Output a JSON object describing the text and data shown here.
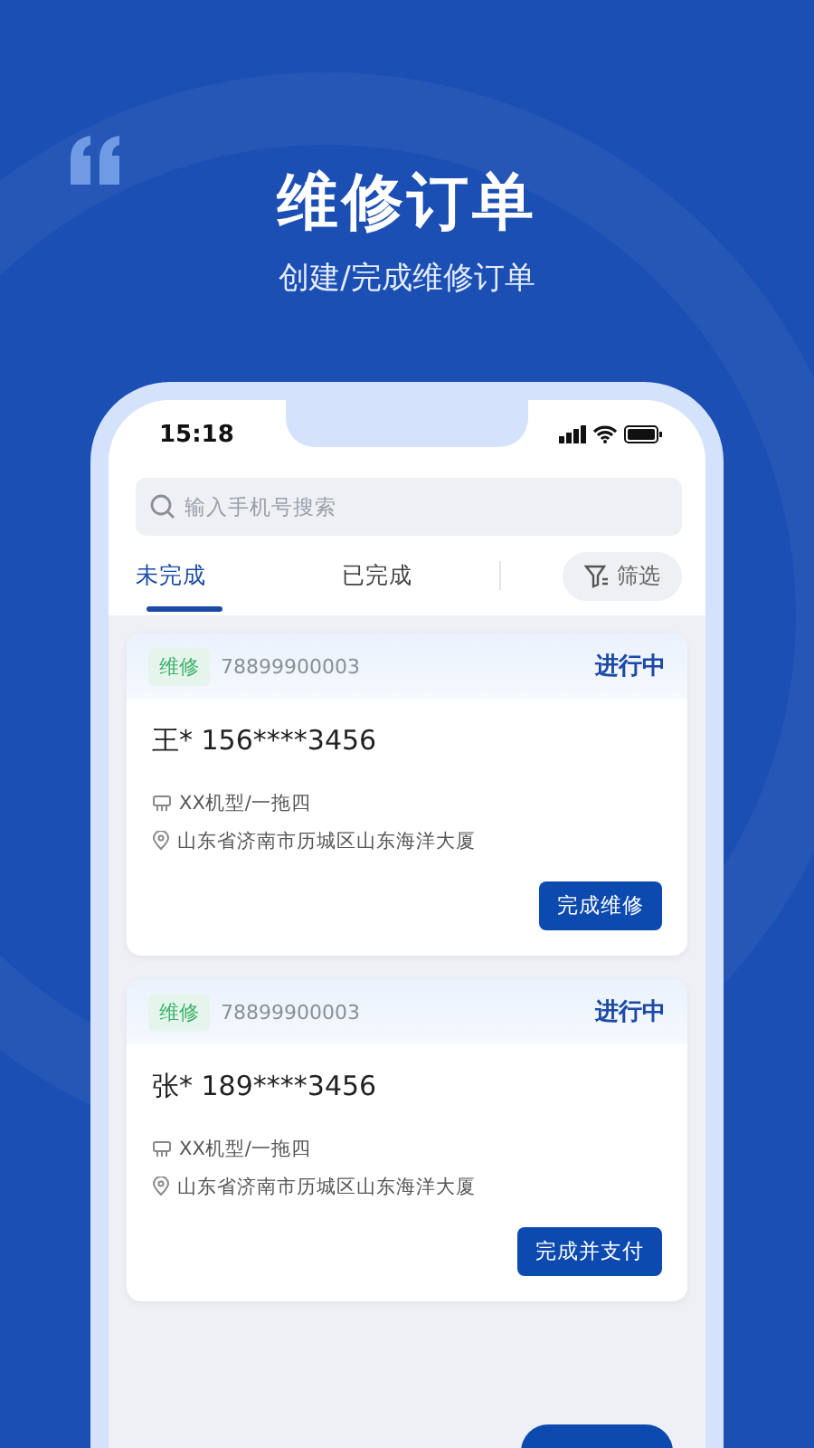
{
  "header": {
    "title": "维修订单",
    "subtitle": "创建/完成维修订单"
  },
  "status_bar": {
    "time": "15:18"
  },
  "search": {
    "placeholder": "输入手机号搜索"
  },
  "tabs": [
    {
      "label": "未完成",
      "selected": true
    },
    {
      "label": "已完成",
      "selected": false
    }
  ],
  "filter_button": {
    "label": "筛选"
  },
  "orders": [
    {
      "tag": "维修",
      "order_no": "78899900003",
      "status": "进行中",
      "customer": "王* 156****3456",
      "device": "XX机型/一拖四",
      "address": "山东省济南市历城区山东海洋大厦",
      "action": "完成维修"
    },
    {
      "tag": "维修",
      "order_no": "78899900003",
      "status": "进行中",
      "customer": "张* 189****3456",
      "device": "XX机型/一拖四",
      "address": "山东省济南市历城区山东海洋大厦",
      "action": "完成并支付"
    }
  ]
}
